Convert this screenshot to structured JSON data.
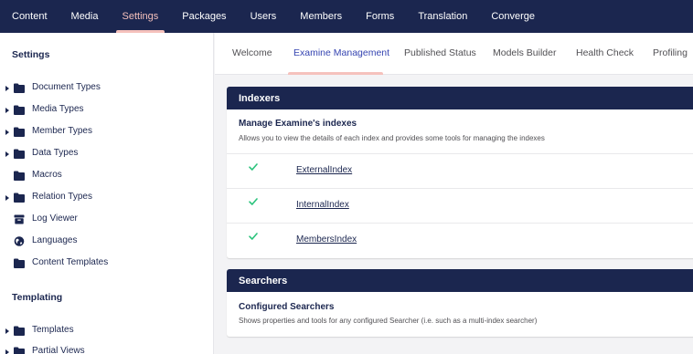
{
  "topnav": {
    "items": [
      {
        "label": "Content"
      },
      {
        "label": "Media"
      },
      {
        "label": "Settings"
      },
      {
        "label": "Packages"
      },
      {
        "label": "Users"
      },
      {
        "label": "Members"
      },
      {
        "label": "Forms"
      },
      {
        "label": "Translation"
      },
      {
        "label": "Converge"
      }
    ],
    "active": "Settings"
  },
  "sidebar": {
    "settings_title": "Settings",
    "items": [
      {
        "label": "Document Types",
        "icon": "folder-icon",
        "expandable": true
      },
      {
        "label": "Media Types",
        "icon": "folder-icon",
        "expandable": true
      },
      {
        "label": "Member Types",
        "icon": "folder-icon",
        "expandable": true
      },
      {
        "label": "Data Types",
        "icon": "folder-icon",
        "expandable": true
      },
      {
        "label": "Macros",
        "icon": "folder-icon",
        "expandable": false
      },
      {
        "label": "Relation Types",
        "icon": "folder-icon",
        "expandable": true
      },
      {
        "label": "Log Viewer",
        "icon": "archive-box-icon",
        "expandable": false
      },
      {
        "label": "Languages",
        "icon": "globe-icon",
        "expandable": false
      },
      {
        "label": "Content Templates",
        "icon": "folder-icon",
        "expandable": false
      }
    ],
    "templating_title": "Templating",
    "templating_items": [
      {
        "label": "Templates",
        "icon": "folder-icon",
        "expandable": true
      },
      {
        "label": "Partial Views",
        "icon": "folder-icon",
        "expandable": true
      }
    ]
  },
  "subtabs": {
    "items": [
      {
        "label": "Welcome"
      },
      {
        "label": "Examine Management"
      },
      {
        "label": "Published Status"
      },
      {
        "label": "Models Builder"
      },
      {
        "label": "Health Check"
      },
      {
        "label": "Profiling"
      }
    ],
    "active": "Examine Management"
  },
  "indexers": {
    "header": "Indexers",
    "heading": "Manage Examine's indexes",
    "description": "Allows you to view the details of each index and provides some tools for managing the indexes",
    "indexes": [
      {
        "name": "ExternalIndex",
        "healthy": true
      },
      {
        "name": "InternalIndex",
        "healthy": true
      },
      {
        "name": "MembersIndex",
        "healthy": true
      }
    ]
  },
  "searchers": {
    "header": "Searchers",
    "heading": "Configured Searchers",
    "description": "Shows properties and tools for any configured Searcher (i.e. such as a multi-index searcher)"
  },
  "colors": {
    "nav_bg": "#1b264f",
    "accent_pink": "#f5c1bc",
    "active_tab": "#3544b1",
    "check_green": "#2bc37c",
    "page_bg": "#f3f3f5"
  }
}
